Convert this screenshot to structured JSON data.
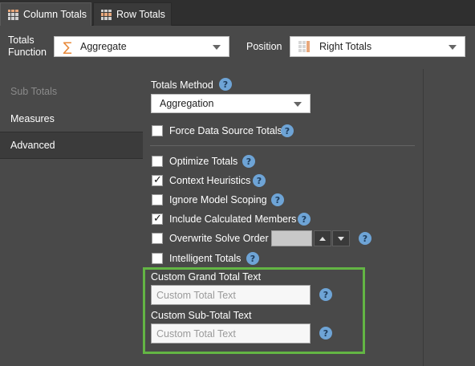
{
  "tabs": [
    {
      "label": "Column Totals",
      "active": true
    },
    {
      "label": "Row Totals",
      "active": false
    }
  ],
  "header": {
    "totals_function_label": "Totals Function",
    "totals_function_value": "Aggregate",
    "position_label": "Position",
    "position_value": "Right Totals"
  },
  "sidebar": {
    "items": [
      {
        "label": "Sub Totals",
        "state": "disabled"
      },
      {
        "label": "Measures",
        "state": "normal"
      },
      {
        "label": "Advanced",
        "state": "selected"
      }
    ]
  },
  "main": {
    "totals_method_label": "Totals Method",
    "totals_method_value": "Aggregation",
    "force_data_source_totals": {
      "label": "Force Data Source Totals",
      "checked": false
    },
    "options": [
      {
        "label": "Optimize Totals",
        "checked": false
      },
      {
        "label": "Context Heuristics",
        "checked": true
      },
      {
        "label": "Ignore Model Scoping",
        "checked": false
      },
      {
        "label": "Include Calculated Members",
        "checked": true
      },
      {
        "label": "Overwrite Solve Order",
        "checked": false
      },
      {
        "label": "Intelligent Totals",
        "checked": false
      }
    ],
    "custom_grand_total": {
      "label": "Custom Grand Total Text",
      "placeholder": "Custom Total Text",
      "value": ""
    },
    "custom_sub_total": {
      "label": "Custom Sub-Total Text",
      "placeholder": "Custom Total Text",
      "value": ""
    }
  },
  "help_icon_glyph": "?",
  "colors": {
    "background": "#494949",
    "accent_help": "#6ea4d6",
    "highlight_box": "#63b544",
    "sigma": "#e8893a"
  },
  "icons": {
    "tab_icon": "grid-icon",
    "function_icon": "sigma-icon",
    "position_icon": "right-totals-icon",
    "help_icon": "question-circle-icon"
  }
}
